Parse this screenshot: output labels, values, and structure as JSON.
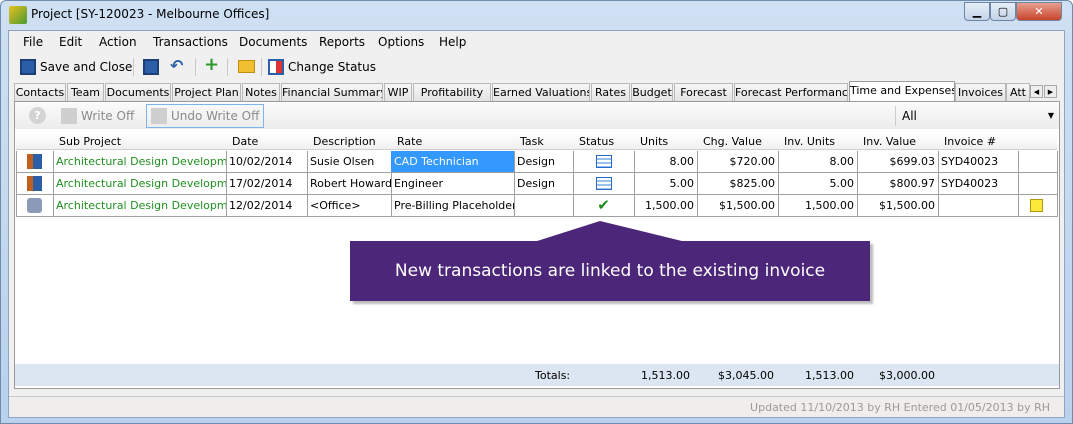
{
  "window": {
    "title": "Project [SY-120023 - Melbourne Offices]",
    "controls": [
      "minimize",
      "maximize",
      "close"
    ]
  },
  "menu": [
    "File",
    "Edit",
    "Action",
    "Transactions",
    "Documents",
    "Reports",
    "Options",
    "Help"
  ],
  "toolbar": {
    "save_close": "Save and Close",
    "change_status": "Change Status"
  },
  "tabs": [
    "Contacts",
    "Team",
    "Documents",
    "Project Plan",
    "Notes",
    "Financial Summary",
    "WIP",
    "Profitability",
    "Earned Valuations",
    "Rates",
    "Budget",
    "Forecast",
    "Forecast Performance",
    "Time and Expenses",
    "Invoices",
    "Att"
  ],
  "active_tab": "Time and Expenses",
  "subtoolbar": {
    "write_off": "Write Off",
    "undo_write_off": "Undo Write Off",
    "filter": "All"
  },
  "grid": {
    "headers": [
      "",
      "Sub Project",
      "Date",
      "Description",
      "Rate",
      "Task",
      "Status",
      "Units",
      "Chg. Value",
      "Inv. Units",
      "Inv. Value",
      "Invoice #",
      ""
    ],
    "rows": [
      {
        "type_icon": "timesheet-icon",
        "sub_project": "Architectural Design Development",
        "date": "10/02/2014",
        "description": "Susie Olsen",
        "rate": "CAD Technician",
        "task": "Design",
        "status_icon": "invoiced-icon",
        "units": "8.00",
        "chg_value": "$720.00",
        "inv_units": "8.00",
        "inv_value": "$699.03",
        "invoice": "SYD40023",
        "note": false
      },
      {
        "type_icon": "timesheet-icon",
        "sub_project": "Architectural Design Development",
        "date": "17/02/2014",
        "description": "Robert Howard",
        "rate": "Engineer",
        "task": "Design",
        "status_icon": "invoiced-icon",
        "units": "5.00",
        "chg_value": "$825.00",
        "inv_units": "5.00",
        "inv_value": "$800.97",
        "invoice": "SYD40023",
        "note": false
      },
      {
        "type_icon": "expense-icon",
        "sub_project": "Architectural Design Development",
        "date": "12/02/2014",
        "description": "<Office>",
        "rate": "Pre-Billing Placeholder",
        "task": "",
        "status_icon": "checkmark-icon",
        "units": "1,500.00",
        "chg_value": "$1,500.00",
        "inv_units": "1,500.00",
        "inv_value": "$1,500.00",
        "invoice": "",
        "note": true
      }
    ],
    "selected_cell": "CAD Technician"
  },
  "totals": {
    "label": "Totals:",
    "units": "1,513.00",
    "chg_value": "$3,045.00",
    "inv_units": "1,513.00",
    "inv_value": "$3,000.00"
  },
  "statusbar": "Updated 11/10/2013 by RH  Entered 01/05/2013 by RH",
  "callout": {
    "text": "New transactions are linked to the existing invoice",
    "color": "#4c2679"
  }
}
